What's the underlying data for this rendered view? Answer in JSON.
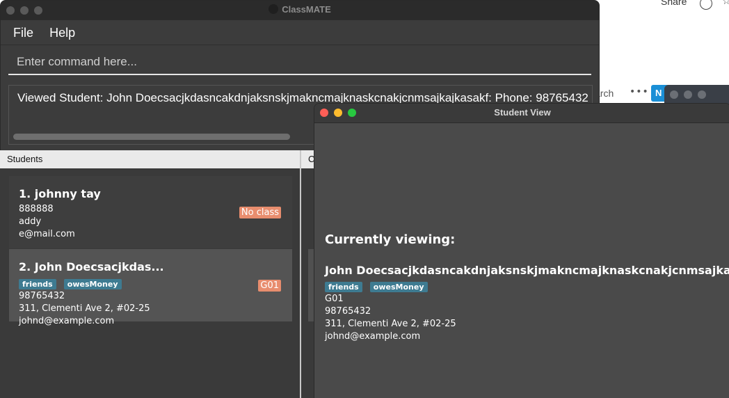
{
  "background": {
    "share_label": "Share",
    "search_label": "arch",
    "more_label": "•••",
    "blue_button_label": "N"
  },
  "main_window": {
    "title": "ClassMATE",
    "menu": [
      "File",
      "Help"
    ],
    "command_placeholder": "Enter command here...",
    "result_text": "Viewed Student: John Doecsacjkdasncakdnjaksnskjmakncmajknaskcnakjcnmsajkajkasakf: Phone: 98765432",
    "panels": {
      "students": "Students",
      "classes": "C"
    },
    "students": [
      {
        "index_name": "1.  johnny tay",
        "tags": [],
        "phone": "888888",
        "address": "addy",
        "email": "e@mail.com",
        "class": "No class"
      },
      {
        "index_name": "2.  John Doecsacjkdas...",
        "tags": [
          "friends",
          "owesMoney"
        ],
        "phone": "98765432",
        "address": "311, Clementi Ave 2, #02-25",
        "email": "johnd@example.com",
        "class": "G01"
      }
    ]
  },
  "student_view": {
    "title": "Student View",
    "heading": "Currently viewing:",
    "name": "John Doecsacjkdasncakdnjaksnskjmakncmajknaskcnakjcnmsajkajkasakf",
    "tags": [
      "friends",
      "owesMoney"
    ],
    "class": "G01",
    "phone": "98765432",
    "address": "311, Clementi Ave 2, #02-25",
    "email": "johnd@example.com"
  },
  "colors": {
    "window_bg": "#3c3c3c",
    "tag_bg": "#3e7b91",
    "class_badge_bg": "#e88d6e",
    "selected_card_bg": "#545454"
  }
}
